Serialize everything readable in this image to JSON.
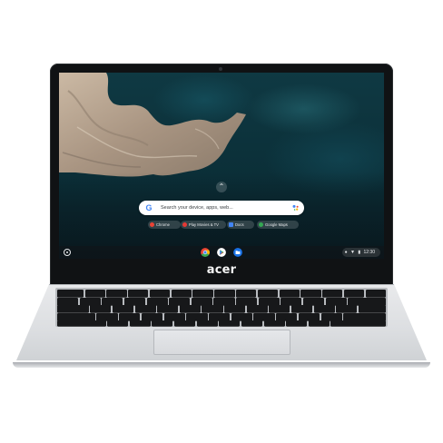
{
  "launcher": {
    "search_placeholder": "Search your device, apps, web...",
    "google_letter": "G",
    "suggestions": [
      {
        "label": "Chrome",
        "color": "#ea4335"
      },
      {
        "label": "Play Movies & TV",
        "color": "#e53935"
      },
      {
        "label": "Docs",
        "color": "#4285f4"
      },
      {
        "label": "Google Maps",
        "color": "#34a853"
      }
    ]
  },
  "shelf": {
    "apps": [
      {
        "name": "chrome-app",
        "color": "#ea4335"
      },
      {
        "name": "play-store-app",
        "color": "#34a853"
      },
      {
        "name": "files-app",
        "color": "#1a73e8"
      }
    ],
    "status": {
      "time": "12:30"
    }
  },
  "device": {
    "brand": "acer"
  },
  "colors": {
    "accent": "#4285f4"
  }
}
